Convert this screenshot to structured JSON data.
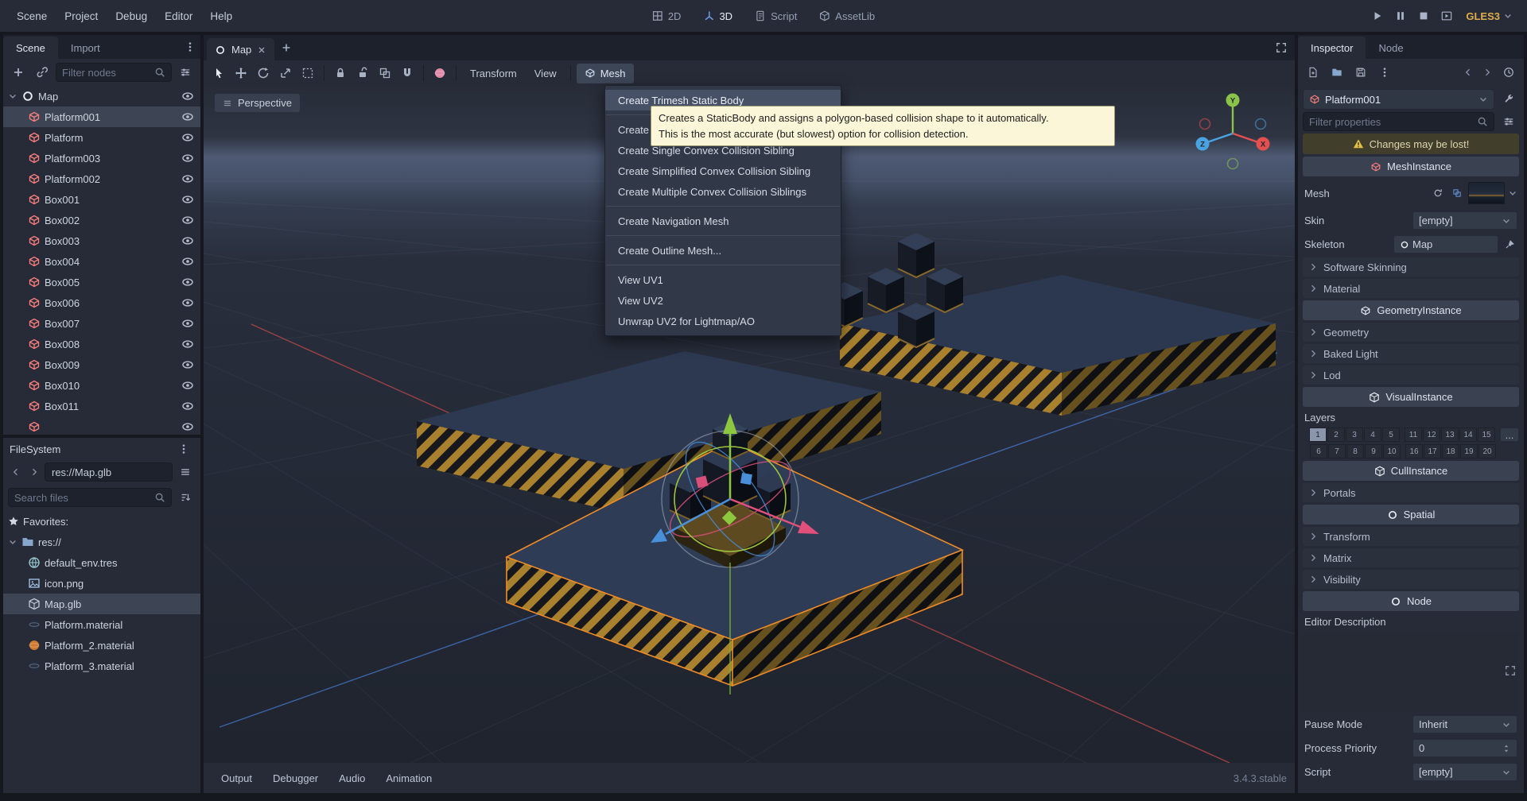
{
  "menubar": {
    "menus": [
      "Scene",
      "Project",
      "Debug",
      "Editor",
      "Help"
    ],
    "workspaces": [
      "2D",
      "3D",
      "Script",
      "AssetLib"
    ],
    "active_workspace": "3D",
    "renderer": "GLES3"
  },
  "scene_dock": {
    "tabs": [
      "Scene",
      "Import"
    ],
    "filter_placeholder": "Filter nodes",
    "tree": [
      {
        "label": "Map"
      },
      {
        "label": "Platform001"
      },
      {
        "label": "Platform"
      },
      {
        "label": "Platform003"
      },
      {
        "label": "Platform002"
      },
      {
        "label": "Box001"
      },
      {
        "label": "Box002"
      },
      {
        "label": "Box003"
      },
      {
        "label": "Box004"
      },
      {
        "label": "Box005"
      },
      {
        "label": "Box006"
      },
      {
        "label": "Box007"
      },
      {
        "label": "Box008"
      },
      {
        "label": "Box009"
      },
      {
        "label": "Box010"
      },
      {
        "label": "Box011"
      }
    ]
  },
  "filesystem": {
    "title": "FileSystem",
    "path": "res://Map.glb",
    "search_placeholder": "Search files",
    "favorites_label": "Favorites:",
    "root_label": "res://",
    "files": [
      {
        "name": "default_env.tres"
      },
      {
        "name": "icon.png"
      },
      {
        "name": "Map.glb"
      },
      {
        "name": "Platform.material"
      },
      {
        "name": "Platform_2.material"
      },
      {
        "name": "Platform_3.material"
      }
    ]
  },
  "viewport": {
    "tab": "Map",
    "perspective_label": "Perspective",
    "transform_menu": "Transform",
    "view_menu": "View",
    "mesh_menu_label": "Mesh"
  },
  "mesh_menu": {
    "items": [
      "Create Trimesh Static Body",
      "Create Trimesh Collision Sibling",
      "Create Single Convex Collision Sibling",
      "Create Simplified Convex Collision Sibling",
      "Create Multiple Convex Collision Siblings",
      "Create Navigation Mesh",
      "Create Outline Mesh...",
      "View UV1",
      "View UV2",
      "Unwrap UV2 for Lightmap/AO"
    ]
  },
  "tooltip": {
    "line1": "Creates a StaticBody and assigns a polygon-based collision shape to it automatically.",
    "line2": "This is the most accurate (but slowest) option for collision detection."
  },
  "statusbar": {
    "items": [
      "Output",
      "Debugger",
      "Audio",
      "Animation"
    ],
    "version": "3.4.3.stable"
  },
  "inspector": {
    "tabs": [
      "Inspector",
      "Node"
    ],
    "node_name": "Platform001",
    "filter_placeholder": "Filter properties",
    "warning": "Changes may be lost!",
    "headers": {
      "mesh_instance": "MeshInstance",
      "geometry_instance": "GeometryInstance",
      "visual_instance": "VisualInstance",
      "cull_instance": "CullInstance",
      "spatial": "Spatial",
      "node": "Node"
    },
    "props": {
      "mesh": "Mesh",
      "skin": "Skin",
      "skin_value": "[empty]",
      "skeleton": "Skeleton",
      "skeleton_value": "Map",
      "software_skinning": "Software Skinning",
      "material": "Material",
      "geometry": "Geometry",
      "baked_light": "Baked Light",
      "lod": "Lod",
      "layers": "Layers",
      "layers_more": "...",
      "portals": "Portals",
      "transform": "Transform",
      "matrix": "Matrix",
      "visibility": "Visibility",
      "editor_description": "Editor Description",
      "pause_mode": "Pause Mode",
      "pause_mode_value": "Inherit",
      "process_priority": "Process Priority",
      "process_priority_value": "0",
      "script": "Script",
      "script_value": "[empty]"
    },
    "layers_row1": [
      "1",
      "2",
      "3",
      "4",
      "5",
      "11",
      "12",
      "13",
      "14",
      "15"
    ],
    "layers_row2": [
      "6",
      "7",
      "8",
      "9",
      "10",
      "16",
      "17",
      "18",
      "19",
      "20"
    ]
  },
  "icons": {
    "axis_x_color": "#e4504f",
    "axis_y_color": "#8bc34a",
    "axis_z_color": "#4aa3e0",
    "selection_color": "#f08c28",
    "accent_color": "#699ce8",
    "warning_color": "#e2c044",
    "mesh_node_color": "#fc7f7f",
    "material_orange": "#cf7a2e",
    "material_dark": "#202a3a",
    "hazard_gold": "#a8802e"
  }
}
